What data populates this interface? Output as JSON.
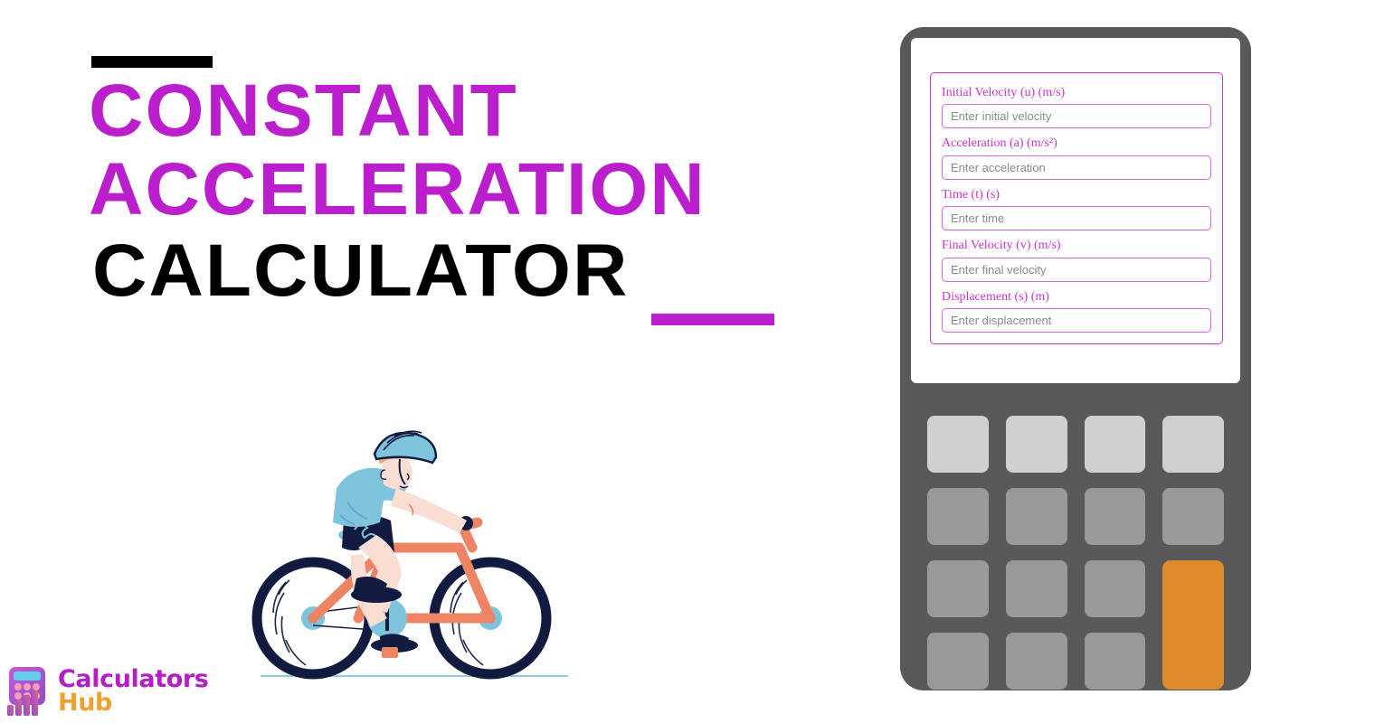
{
  "page": {
    "title_line_1": "Constant",
    "title_line_2": "Acceleration",
    "title_line_3": "Calculator",
    "accent_color": "#bb1ecc",
    "dark_color": "#000000"
  },
  "brand": {
    "name_part_1": "Calculators",
    "name_part_2": "Hub",
    "mark_icon": "calculator-bars-logo-icon",
    "color_1": "#b51ec6",
    "color_2": "#f0a030"
  },
  "illustration": {
    "name": "cyclist-illustration",
    "jersey_color": "#7fc4dd",
    "shorts_color": "#0f1f4b",
    "frame_color": "#ef8465",
    "wheel_color": "#101b3f",
    "skin_color": "#fbded3",
    "ground_color": "#8ecae6"
  },
  "calculator": {
    "body_color": "#595959",
    "screen_color": "#ffffff",
    "card_border_color": "#cc33cc",
    "fields": [
      {
        "label": "Initial Velocity (u) (m/s)",
        "placeholder": "Enter initial velocity",
        "value": ""
      },
      {
        "label": "Acceleration (a) (m/s²)",
        "placeholder": "Enter acceleration",
        "value": ""
      },
      {
        "label": "Time (t) (s)",
        "placeholder": "Enter time",
        "value": ""
      },
      {
        "label": "Final Velocity (v) (m/s)",
        "placeholder": "Enter final velocity",
        "value": ""
      },
      {
        "label": "Displacement (s) (m)",
        "placeholder": "Enter displacement",
        "value": ""
      }
    ],
    "keypad": {
      "light_key_color": "#d0d0d0",
      "medium_key_color": "#999999",
      "accent_key_color": "#e08a2e",
      "keys": [
        {
          "label": "",
          "style": "light"
        },
        {
          "label": "",
          "style": "light"
        },
        {
          "label": "",
          "style": "light"
        },
        {
          "label": "",
          "style": "light"
        },
        {
          "label": "",
          "style": "medium"
        },
        {
          "label": "",
          "style": "medium"
        },
        {
          "label": "",
          "style": "medium"
        },
        {
          "label": "",
          "style": "medium"
        },
        {
          "label": "",
          "style": "medium"
        },
        {
          "label": "",
          "style": "medium"
        },
        {
          "label": "",
          "style": "medium"
        },
        {
          "label": "",
          "style": "medium"
        },
        {
          "label": "",
          "style": "medium"
        },
        {
          "label": "",
          "style": "medium"
        }
      ],
      "accent_key": {
        "label": "",
        "style": "accent"
      }
    }
  }
}
